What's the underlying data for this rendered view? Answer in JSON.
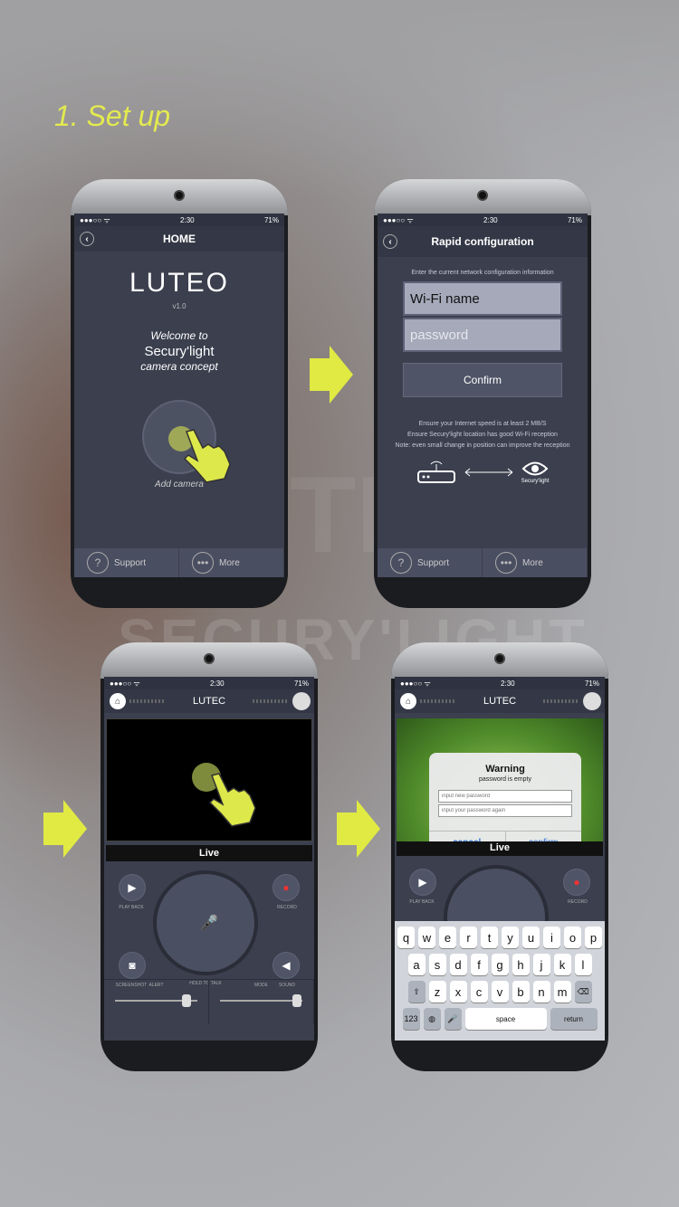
{
  "heading": "1. Set up",
  "watermark": "SECURY'LIGHT",
  "colors": {
    "accent": "#e3ea4f",
    "screen_bg": "#3b3f4e"
  },
  "status": {
    "time": "2:30",
    "battery": "71%"
  },
  "phone1": {
    "title": "HOME",
    "logo": "LUTEO",
    "version": "v1.0",
    "welcome_line1": "Welcome to",
    "welcome_line2": "Secury'light",
    "welcome_line3": "camera concept",
    "add_label": "Add camera",
    "tabs": [
      {
        "label": "Support",
        "icon": "question-icon"
      },
      {
        "label": "More",
        "icon": "more-dots-icon"
      }
    ]
  },
  "phone2": {
    "title": "Rapid configuration",
    "hint": "Enter the current network configuration information",
    "wifi_value": "Wi-Fi name",
    "password_placeholder": "password",
    "confirm_label": "Confirm",
    "note1": "Ensure your Internet speed is at least 2 MB/S",
    "note2": "Ensure Secury'light location has good Wi-Fi reception",
    "note3": "Note: even small change in position can improve the reception",
    "device_label": "Secury'light",
    "tabs": [
      {
        "label": "Support"
      },
      {
        "label": "More"
      }
    ]
  },
  "phone3": {
    "title": "LUTEC",
    "live": "Live",
    "playback": "PLAY BACK",
    "record": "RECORD",
    "screenshot": "SCREENSHOT",
    "hold": "HOLD TO TALK",
    "sound": "SOUND",
    "alert": "ALERT",
    "mode": "MODE"
  },
  "phone4": {
    "title": "LUTEC",
    "live": "Live",
    "playback": "PLAY BACK",
    "record": "RECORD",
    "warning_title": "Warning",
    "warning_msg": "password is empty",
    "new_pw_placeholder": "input new password",
    "again_pw_placeholder": "input your password again",
    "cancel": "cancel",
    "confirm": "confirm",
    "keyboard": {
      "row1": [
        "q",
        "w",
        "e",
        "r",
        "t",
        "y",
        "u",
        "i",
        "o",
        "p"
      ],
      "row2": [
        "a",
        "s",
        "d",
        "f",
        "g",
        "h",
        "j",
        "k",
        "l"
      ],
      "row3": [
        "z",
        "x",
        "c",
        "v",
        "b",
        "n",
        "m"
      ],
      "num": "123",
      "space": "space",
      "return": "return"
    }
  }
}
